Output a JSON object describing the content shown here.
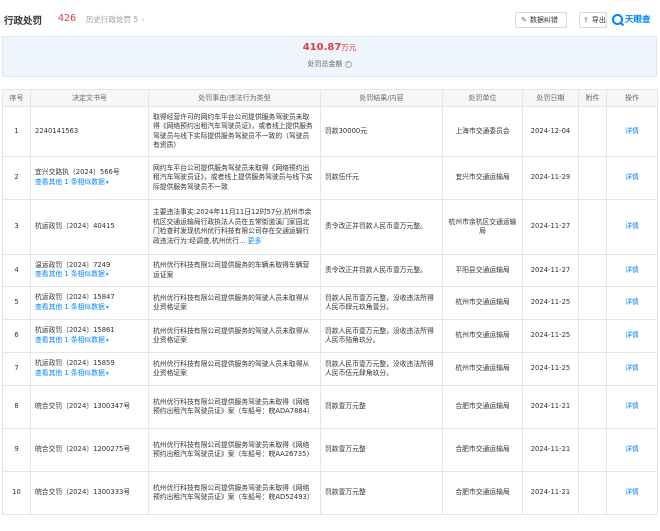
{
  "header": {
    "title": "行政处罚",
    "count": "426",
    "history_label": "历史行政处罚",
    "history_count": "5",
    "report_button": "数据纠错",
    "export_button": "导出",
    "brand": "天眼查"
  },
  "summary": {
    "amount": "410.87",
    "unit": "万元",
    "label": "处罚总金额"
  },
  "table": {
    "columns": [
      "序号",
      "决定文书号",
      "处罚事由/违法行为类型",
      "处罚结果/内容",
      "处罚单位",
      "处罚日期",
      "附件",
      "操作"
    ],
    "detail_label": "详情",
    "more_label": "更多",
    "rows": [
      {
        "no": "1",
        "doc": "2240141563",
        "doc_sub": "",
        "reason": "取得经营许可的网约车平台公司提供服务驾驶员未取得《网络预约出租汽车驾驶员证》，或者线上提供服务驾驶员与线下实际提供服务驾驶员不一致的（驾驶员有资质）",
        "result": "罚款30000元",
        "unit": "上海市交通委员会",
        "date": "2024-12-04"
      },
      {
        "no": "2",
        "doc": "宜兴交路执〔2024〕566号",
        "doc_sub": "查看其他 1 条相似数据",
        "reason": "网约车平台公司提供服务驾驶员未取得《网络预约出租汽车驾驶员证》，或者线上提供服务驾驶员与线下实际提供服务驾驶员不一致",
        "result": "罚款伍仟元",
        "unit": "宜兴市交通运输局",
        "date": "2024-11-29"
      },
      {
        "no": "3",
        "doc": "杭运政罚〔2024〕40415",
        "doc_sub": "",
        "reason": "主要违法事实:2024年11月11日12时57分,杭州市余杭区交通运输局行政执法人员在五常街道溪门家园北门检查时发现杭州优行科技有限公司存在交通运输行政违法行为:经调查,杭州优行...",
        "result": "责令改正并罚款人民币壹万元整。",
        "unit": "杭州市余杭区交通运输局",
        "date": "2024-11-27"
      },
      {
        "no": "4",
        "doc": "温运政罚〔2024〕7249",
        "doc_sub": "查看其他 1 条相似数据",
        "reason": "杭州优行科技有限公司提供服务的车辆未取得车辆营运证案",
        "result": "责令改正并罚款人民币壹万元整。",
        "unit": "平阳县交通运输局",
        "date": "2024-11-27"
      },
      {
        "no": "5",
        "doc": "杭运政罚〔2024〕15847",
        "doc_sub": "查看其他 1 条相似数据",
        "reason": "杭州优行科技有限公司提供服务的驾驶人员未取得从业资格证案",
        "result": "罚款人民币壹万元整，没收违法所得人民币肆元玖角壹分。",
        "unit": "杭州市交通运输局",
        "date": "2024-11-25"
      },
      {
        "no": "6",
        "doc": "杭运政罚〔2024〕15861",
        "doc_sub": "查看其他 1 条相似数据",
        "reason": "杭州优行科技有限公司提供服务的驾驶人员未取得从业资格证案",
        "result": "罚款人民币壹万元整，没收违法所得人民币陆角玖分。",
        "unit": "杭州市交通运输局",
        "date": "2024-11-25"
      },
      {
        "no": "7",
        "doc": "杭运政罚〔2024〕15859",
        "doc_sub": "查看其他 1 条相似数据",
        "reason": "杭州优行科技有限公司提供服务的驾驶人员未取得从业资格证案",
        "result": "罚款人民币壹万元整，没收违法所得人民币伍元肆角玖分。",
        "unit": "杭州市交通运输局",
        "date": "2024-11-25"
      },
      {
        "no": "8",
        "doc": "皖合交罚〔2024〕1300347号",
        "doc_sub": "",
        "reason": "杭州优行科技有限公司提供服务驾驶员未取得《网络预约出租汽车驾驶员证》案（车船号：皖ADA7884）",
        "result": "罚款壹万元整",
        "unit": "合肥市交通运输局",
        "date": "2024-11-21"
      },
      {
        "no": "9",
        "doc": "皖合交罚〔2024〕1200275号",
        "doc_sub": "",
        "reason": "杭州优行科技有限公司提供服务驾驶员未取得《网络预约出租汽车驾驶员证》案（车船号：皖AA26735）",
        "result": "罚款壹万元整",
        "unit": "合肥市交通运输局",
        "date": "2024-11-21"
      },
      {
        "no": "10",
        "doc": "皖合交罚〔2024〕1300333号",
        "doc_sub": "",
        "reason": "杭州优行科技有限公司提供服务驾驶员未取得《网络预约出租汽车驾驶员证》案（车船号：皖AD52493）",
        "result": "罚款壹万元整",
        "unit": "合肥市交通运输局",
        "date": "2024-11-21"
      }
    ]
  }
}
